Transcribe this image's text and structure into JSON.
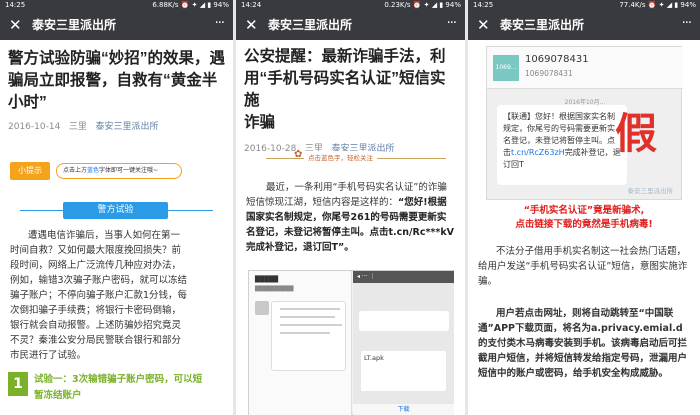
{
  "panels": [
    {
      "status": {
        "time": "14:25",
        "right": "6.88K/s ⏰ ✦ ◢ ▮ 94%"
      },
      "nav": {
        "close": "✕",
        "title": "泰安三里派出所",
        "more": "···"
      },
      "headline": [
        "警方试验防骗“妙招”的效果，遇",
        "骗局立即报警，自救有“黄金半",
        "小时”"
      ],
      "meta": {
        "date": "2016-10-14",
        "author": "三里",
        "account": "泰安三里派出所"
      },
      "tip_badge": "小提示",
      "tip_text_pre": "点击上方",
      "tip_text_blue": "蓝色",
      "tip_text_post": "字体即可一键关注哦~",
      "section_title": "警方试验",
      "body": [
        "遭遇电信诈骗后，当事人如何在第一",
        "时间自救？又如何最大限度挽回损失？前",
        "段时间，网络上广泛流传几种应对办法，",
        "例如，输错3次骗子账户密码，就可以冻结",
        "骗子账户；不停向骗子账户汇款1分钱，每",
        "次倒扣骗子手续费；将银行卡密码倒输，",
        "银行就会自动报警。上述防骗妙招究竟灵",
        "不灵？秦淮公安分局民警联合银行和部分",
        "市民进行了试验。"
      ],
      "item_num": "1",
      "item_text": [
        "试验一：3次输错骗子账户密码，可以短",
        "暂冻结账户"
      ]
    },
    {
      "status": {
        "time": "14:24",
        "right": "0.23K/s ⏰ ✦ ◢ ▮ 94%"
      },
      "nav": {
        "close": "✕",
        "title": "泰安三里派出所",
        "more": "···"
      },
      "headline": [
        "公安提醒：最新诈骗手法，利",
        "用“手机号码实名认证”短信实施",
        "诈骗"
      ],
      "meta": {
        "date": "2016-10-28",
        "author": "三里",
        "account": "泰安三里派出所"
      },
      "banner": "点击蓝色字，轻松关注",
      "body_normal": "最近，一条利用“手机号码实名认证”的诈骗短信惊现江湖，短信内容是这样的：",
      "body_bold": "“您好!根据国家实名制规定，你尾号261的号码需要更新实名登记，未登记将暂停主叫。点击t.cn/Rc***kV完成补登记，退订回T”。",
      "apk_label": "LT.apk",
      "bottom_link": "下载"
    },
    {
      "status": {
        "time": "14:25",
        "right": "77.4K/s ⏰ ✦ ◢ ▮ 94%"
      },
      "nav": {
        "close": "✕",
        "title": "泰安三里派出所",
        "more": "···"
      },
      "sms": {
        "number": "1069078431",
        "number2": "1069078431",
        "date": "2016年10月...",
        "avatar": "1069...",
        "text_pre": "【联通】您好！根据国家实名制规定，你尾号",
        "text_mid": "的号码需要更新实名登记，未登记将暂停主叫。点击",
        "link": "t.cn/RcZ63zH",
        "text_post": "完成补登记，退订回T",
        "stamp": "假",
        "watermark": "泰安三里派出所"
      },
      "red_lines": [
        "“手机实名认证”竟是新骗术,",
        "点击链接下载的竟然是手机病毒!"
      ],
      "body1": "不法分子借用手机实名制这一社会热门话题，给用户发送“手机号码实名认证”短信，意图实施诈骗。",
      "body2": "用户若点击网址，则将自动跳转至“中国联通”APP下载页面，将名为a.privacy.emial.d的支付类木马病毒安装到手机。该病毒启动后可拦截用户短信，并将短信转发给指定号码，泄漏用户短信中的账户或密码，给手机安全构成威胁。"
    }
  ]
}
